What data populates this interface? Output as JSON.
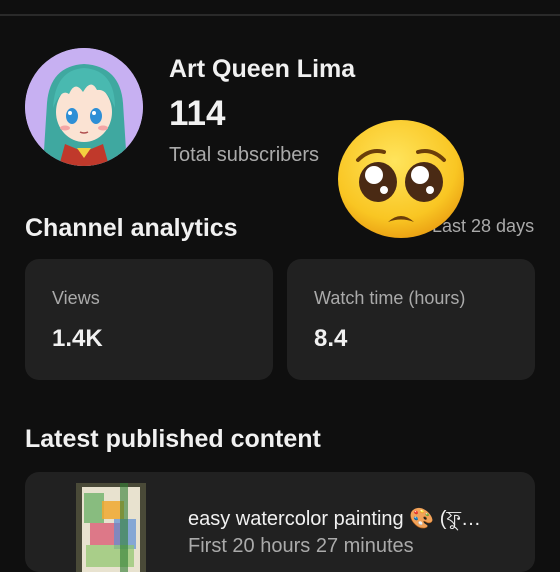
{
  "channel": {
    "name": "Art Queen Lima",
    "subscriber_count": "114",
    "subscriber_label": "Total subscribers"
  },
  "analytics": {
    "title": "Channel analytics",
    "period": "Last 28 days",
    "cards": [
      {
        "label": "Views",
        "value": "1.4K"
      },
      {
        "label": "Watch time (hours)",
        "value": "8.4"
      }
    ]
  },
  "latest": {
    "title": "Latest published content",
    "video": {
      "title": "easy watercolor painting 🎨 (ফু…",
      "meta": "First 20 hours 27 minutes"
    }
  },
  "colors": {
    "background": "#0f0f0f",
    "card": "#212121",
    "secondary_text": "#aaaaaa",
    "avatar_bg": "#c7b0f2",
    "emoji_yellow": "#f9c623"
  },
  "icons": {
    "overlay": "pleading-face-emoji",
    "avatar": "anime-girl-avatar"
  }
}
